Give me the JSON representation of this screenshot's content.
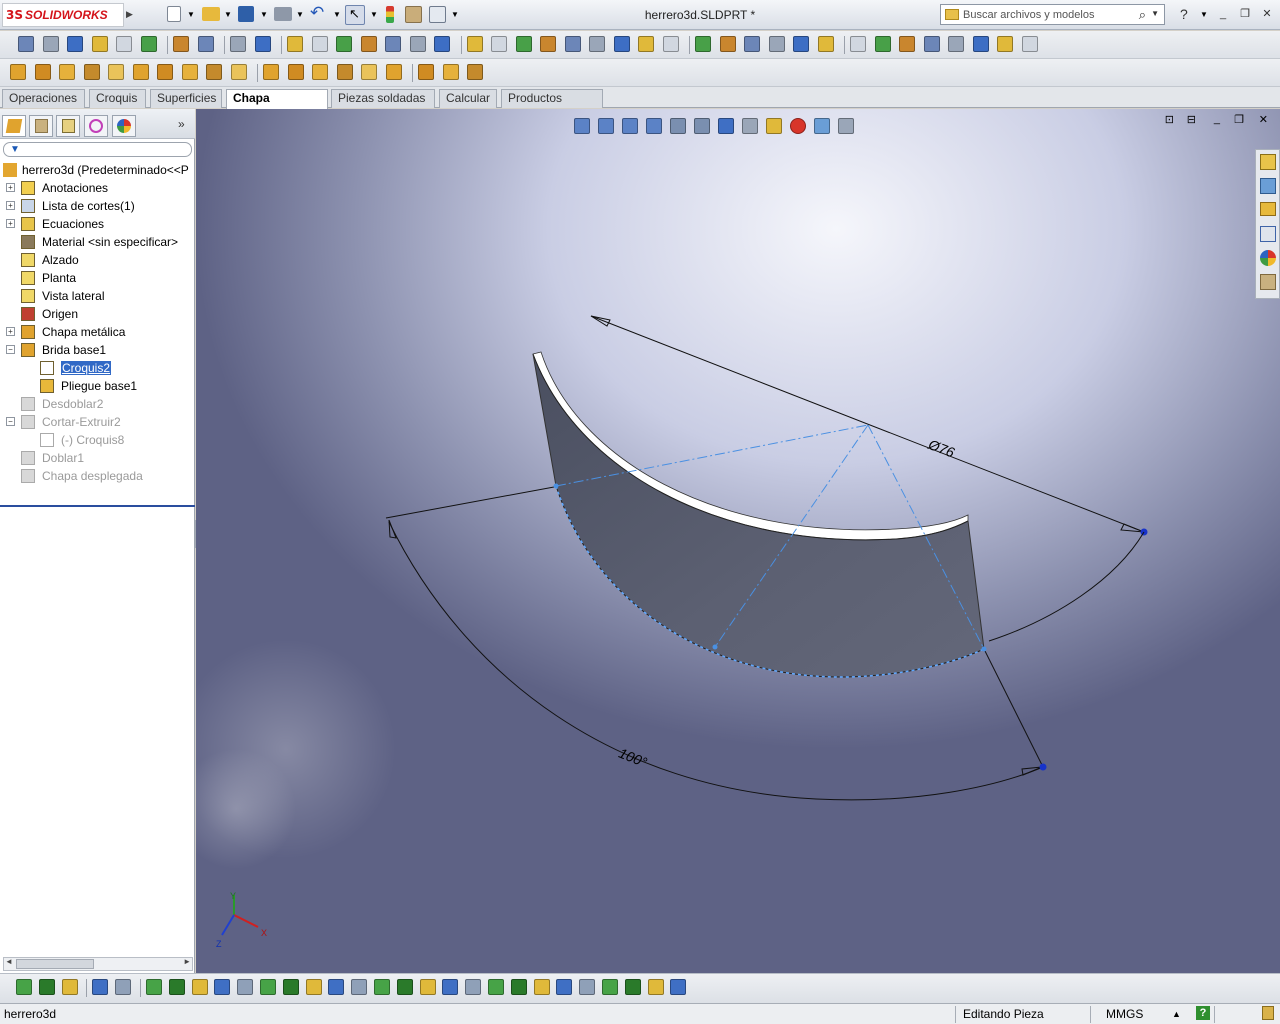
{
  "app": {
    "title": "herrero3d.SLDPRT *",
    "logo_prefix": "3S",
    "logo_text": "SOLIDWORKS",
    "search_placeholder": "Buscar archivos y modelos",
    "help_label": "?"
  },
  "tabs": [
    {
      "label": "Operaciones",
      "active": false
    },
    {
      "label": "Croquis",
      "active": false
    },
    {
      "label": "Superficies",
      "active": false
    },
    {
      "label": "Chapa metálica",
      "active": true
    },
    {
      "label": "Piezas soldadas",
      "active": false
    },
    {
      "label": "Calcular",
      "active": false
    },
    {
      "label": "Productos Office",
      "active": false
    }
  ],
  "tree": {
    "root": "herrero3d  (Predeterminado<<P",
    "items": [
      {
        "label": "Anotaciones",
        "icon": "annotations-icon"
      },
      {
        "label": "Lista de cortes(1)",
        "icon": "cut-list-icon"
      },
      {
        "label": "Ecuaciones",
        "icon": "equations-icon"
      },
      {
        "label": "Material <sin especificar>",
        "icon": "material-icon"
      },
      {
        "label": "Alzado",
        "icon": "plane-icon"
      },
      {
        "label": "Planta",
        "icon": "plane-icon"
      },
      {
        "label": "Vista lateral",
        "icon": "plane-icon"
      },
      {
        "label": "Origen",
        "icon": "origin-icon"
      },
      {
        "label": "Chapa metálica",
        "icon": "sheet-metal-icon"
      },
      {
        "label": "Brida base1",
        "icon": "base-flange-icon"
      },
      {
        "label": "Croquis2",
        "icon": "sketch-icon",
        "selected": true
      },
      {
        "label": "Pliegue base1",
        "icon": "bend-icon"
      },
      {
        "label": "Desdoblar2",
        "icon": "unfold-icon",
        "dimmed": true
      },
      {
        "label": "Cortar-Extruir2",
        "icon": "cut-extrude-icon",
        "dimmed": true
      },
      {
        "label": "(-) Croquis8",
        "icon": "sketch-icon",
        "dimmed": true
      },
      {
        "label": "Doblar1",
        "icon": "fold-icon",
        "dimmed": true
      },
      {
        "label": "Chapa desplegada",
        "icon": "flat-pattern-icon",
        "dimmed": true
      }
    ]
  },
  "viewport": {
    "dim_diameter": "Ø76",
    "dim_angle": "100°",
    "triad": {
      "x": "X",
      "y": "Y",
      "z": "Z"
    }
  },
  "status": {
    "document": "herrero3d",
    "mode": "Editando Pieza",
    "units": "MMGS",
    "units_arrow": "▲",
    "help": "?"
  },
  "colors": {
    "sheet_dark": "#555a6c",
    "sheet_edge": "#ffffff",
    "sketch_blue": "#4a90e2",
    "tab_active": "#ffffff"
  }
}
